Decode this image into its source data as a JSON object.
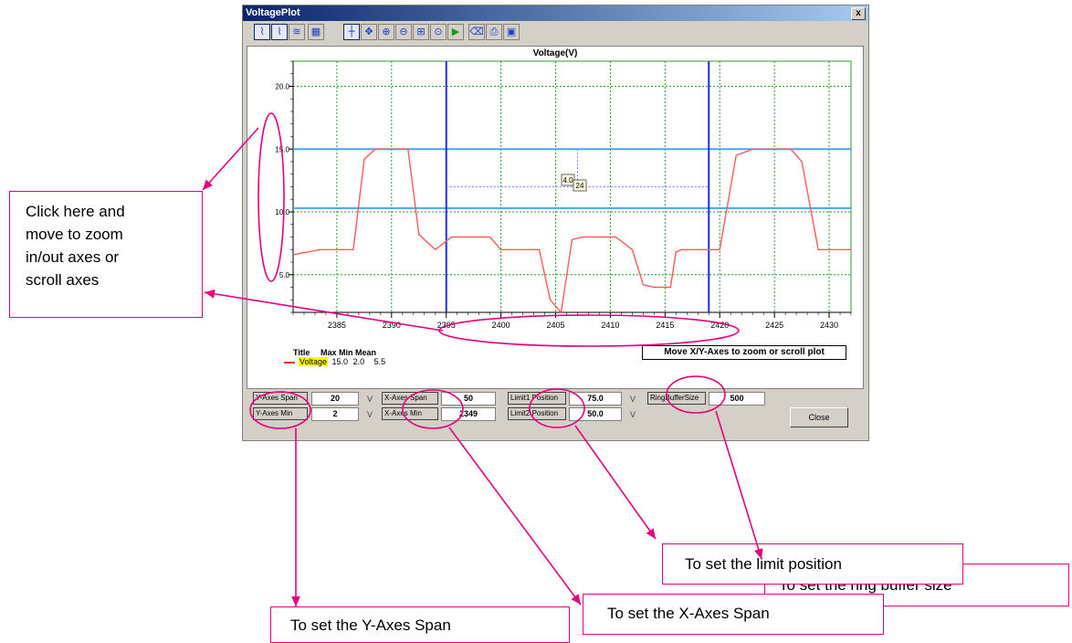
{
  "window": {
    "title": "VoltagePlot",
    "close_glyph": "x"
  },
  "toolbar": {
    "buttons": [
      {
        "icon": "line-plot-icon",
        "glyph": "⌇",
        "selected": true
      },
      {
        "icon": "step-plot-icon",
        "glyph": "⌇",
        "selected": true
      },
      {
        "icon": "multi-trace-icon",
        "glyph": "≋",
        "selected": false
      },
      {
        "icon": "grid-icon",
        "glyph": "▦",
        "selected": false
      },
      {
        "icon": "crosshair-icon",
        "glyph": "┼",
        "selected": true
      },
      {
        "icon": "pan-icon",
        "glyph": "✥",
        "selected": false
      },
      {
        "icon": "zoom-in-icon",
        "glyph": "⊕",
        "selected": false
      },
      {
        "icon": "zoom-out-icon",
        "glyph": "⊖",
        "selected": false
      },
      {
        "icon": "zoom-box-icon",
        "glyph": "⊞",
        "selected": false
      },
      {
        "icon": "zoom-reset-icon",
        "glyph": "⊙",
        "selected": false
      },
      {
        "icon": "play-icon",
        "glyph": "▶",
        "selected": false
      },
      {
        "icon": "eraser-icon",
        "glyph": "⌫",
        "selected": false
      },
      {
        "icon": "print-icon",
        "glyph": "⎙",
        "selected": false
      },
      {
        "icon": "save-icon",
        "glyph": "▣",
        "selected": false
      }
    ]
  },
  "plot": {
    "title": "Voltage(V)",
    "hint": "Move X/Y-Axes to zoom or scroll plot",
    "cursor_labels": [
      "4.0",
      "24"
    ]
  },
  "legend": {
    "header": {
      "title": "Title",
      "max": "Max",
      "min": "Min",
      "mean": "Mean"
    },
    "row": {
      "name": "Voltage",
      "max": "15.0",
      "min": "2.0",
      "mean": "5.5"
    }
  },
  "controls": {
    "y_span": {
      "label": "Y-Axes Span",
      "value": "20",
      "unit": "V"
    },
    "y_min": {
      "label": "Y-Axes Min",
      "value": "2",
      "unit": "V"
    },
    "x_span": {
      "label": "X-Axes Span",
      "value": "50"
    },
    "x_min": {
      "label": "X-Axes Min",
      "value": "2349"
    },
    "limit1": {
      "label": "Limit1 Position",
      "value": "75.0",
      "unit": "V"
    },
    "limit2": {
      "label": "Limit2 Position",
      "value": "50.0",
      "unit": "V"
    },
    "ring": {
      "label": "RingBufferSize",
      "value": "500"
    },
    "close": "Close"
  },
  "callouts": {
    "zoom": [
      "Click here and",
      "move to zoom",
      "in/out axes or",
      "scroll axes"
    ],
    "ring": "To set the ring buffer size",
    "limit": "To set the limit position",
    "y_span": "To set the Y-Axes Span",
    "x_span": "To set the X-Axes Span"
  },
  "colors": {
    "accent": "#e6007e",
    "trace": "#ff5a5a",
    "limit_line": "#4aa3ff",
    "cursor": "#1e2bff",
    "grid": "#2a9d2a"
  },
  "chart_data": {
    "type": "line",
    "title": "Voltage(V)",
    "xlabel": "",
    "ylabel": "",
    "xlim": [
      2381,
      2432
    ],
    "ylim": [
      2,
      22
    ],
    "xticks": [
      2385,
      2390,
      2395,
      2400,
      2405,
      2410,
      2415,
      2420,
      2425,
      2430
    ],
    "yticks": [
      5.0,
      10.0,
      15.0,
      20.0
    ],
    "ytick_labels": [
      "5.0",
      "10.0",
      "15.0",
      "20.0"
    ],
    "grid": true,
    "series": [
      {
        "name": "Voltage",
        "x": [
          2381,
          2383.5,
          2386.5,
          2387.5,
          2388.5,
          2391.5,
          2392.5,
          2394,
          2395.5,
          2396.5,
          2399,
          2400,
          2401,
          2403.5,
          2404.5,
          2405.5,
          2406.5,
          2407.5,
          2408.5,
          2410.5,
          2412,
          2413,
          2414,
          2415,
          2415.5,
          2416,
          2416.5,
          2418,
          2420,
          2421.5,
          2423,
          2424,
          2425,
          2426.5,
          2427.5,
          2429,
          2430.5,
          2432
        ],
        "y": [
          6.6,
          7.0,
          7.0,
          14.2,
          15.0,
          15.0,
          8.2,
          7.0,
          8.0,
          8.0,
          8.0,
          7.0,
          7.0,
          7.0,
          3.0,
          2.0,
          7.8,
          8.0,
          8.0,
          8.0,
          7.0,
          4.2,
          4.0,
          4.0,
          4.0,
          6.8,
          7.0,
          7.0,
          7.0,
          14.5,
          15.0,
          15.0,
          15.0,
          15.0,
          14.0,
          7.0,
          7.0,
          7.0
        ]
      }
    ],
    "limits": [
      15.0,
      10.3
    ],
    "cursors_x": [
      2395,
      2419
    ],
    "cursor_marker": {
      "x": 2407,
      "y": 12
    }
  }
}
